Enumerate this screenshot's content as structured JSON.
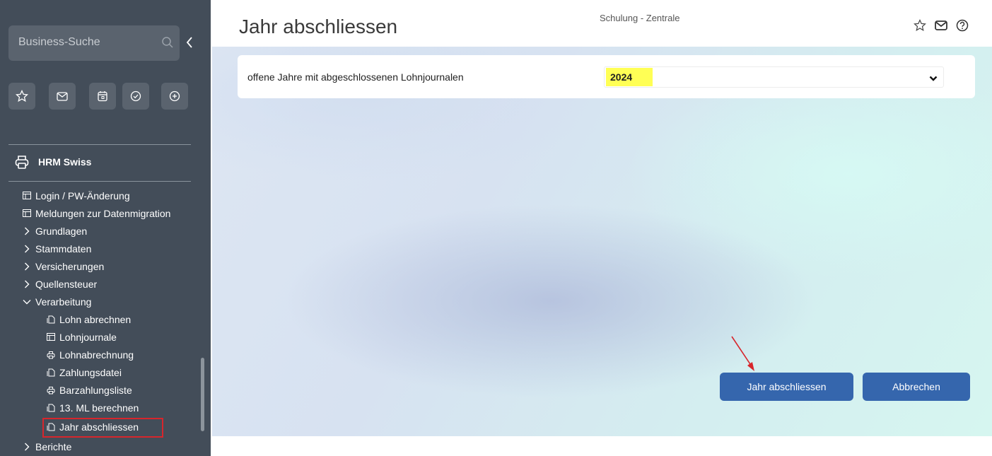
{
  "sidebar": {
    "search_placeholder": "Business-Suche",
    "module_title": "HRM Swiss",
    "nav": [
      {
        "label": "Login / PW-Änderung"
      },
      {
        "label": "Meldungen zur Datenmigration"
      },
      {
        "label": "Grundlagen"
      },
      {
        "label": "Stammdaten"
      },
      {
        "label": "Versicherungen"
      },
      {
        "label": "Quellensteuer"
      },
      {
        "label": "Verarbeitung"
      },
      {
        "label": "Lohn abrechnen"
      },
      {
        "label": "Lohnjournale"
      },
      {
        "label": "Lohnabrechnung"
      },
      {
        "label": "Zahlungsdatei"
      },
      {
        "label": "Barzahlungsliste"
      },
      {
        "label": "13. ML berechnen"
      },
      {
        "label": "Jahr abschliessen"
      },
      {
        "label": "Berichte"
      }
    ]
  },
  "header": {
    "title": "Jahr abschliessen",
    "context": "Schulung - Zentrale"
  },
  "form": {
    "label": "offene Jahre mit abgeschlossenen Lohnjournalen",
    "year_value": "2024"
  },
  "actions": {
    "confirm": "Jahr abschliessen",
    "cancel": "Abbrechen"
  },
  "colors": {
    "sidebar": "#434d59",
    "primary_button": "#3566ad",
    "highlight": "#ffff55",
    "annotation": "#d7262c"
  }
}
